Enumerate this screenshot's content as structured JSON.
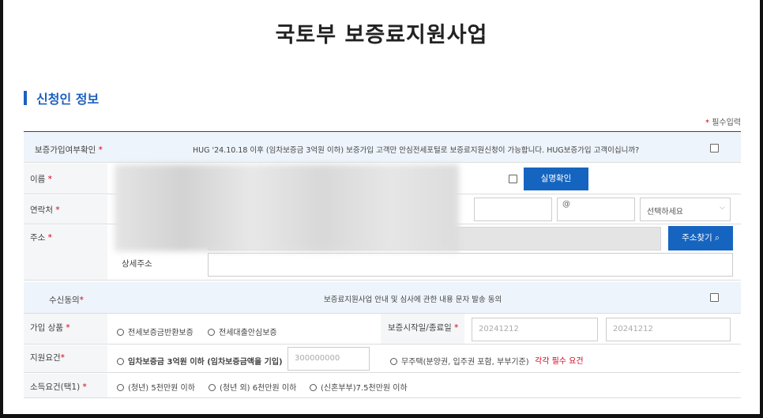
{
  "title": "국토부 보증료지원사업",
  "section_title": "신청인 정보",
  "required_note": "필수입력",
  "required_mark": "*",
  "rows": {
    "hug_label": "보증가입여부확인",
    "hug_text": "HUG '24.10.18 이후 (임차보증금 3억원 이하) 보증가입 고객만 안심전세포털로 보증료지원신청이 가능합니다. HUG보증가입 고객이십니까?",
    "name_label": "이름",
    "verify_button": "실명확인",
    "contact_label": "연락처",
    "email_at": "@",
    "email_select": "선택하세요",
    "address_label": "주소",
    "address_button": "주소찾기",
    "detail_address_label": "상세주소",
    "consent_label": "수신동의",
    "consent_text": "보증료지원사업 안내 및 심사에 관한 내용 문자 발송 동의",
    "product_label": "가입 상품",
    "product_options": [
      "전세보증금반환보증",
      "전세대출안심보증"
    ],
    "period_label": "보증시작일/종료일",
    "start_date": "20241212",
    "end_date": "20241212",
    "support_label": "지원요건",
    "support_option1": "임차보증금 3억원 이하 (임차보증금액을 기입)",
    "support_amount_placeholder": "300000000",
    "support_option2": "무주택(분양권, 입주권 포함, 부부기준)",
    "support_note": "각각 필수 요건",
    "income_label": "소득요건(택1)",
    "income_options": [
      "(청년) 5천만원 이하",
      "(청년 외) 6천만원 이하",
      "(신혼부부)7.5천만원 이하"
    ]
  },
  "icons": {
    "search": "search-icon",
    "dropdown": "chevron-down-icon"
  },
  "colors": {
    "accent": "#1c5fbf",
    "button": "#1565c0",
    "required": "#d0021b"
  }
}
